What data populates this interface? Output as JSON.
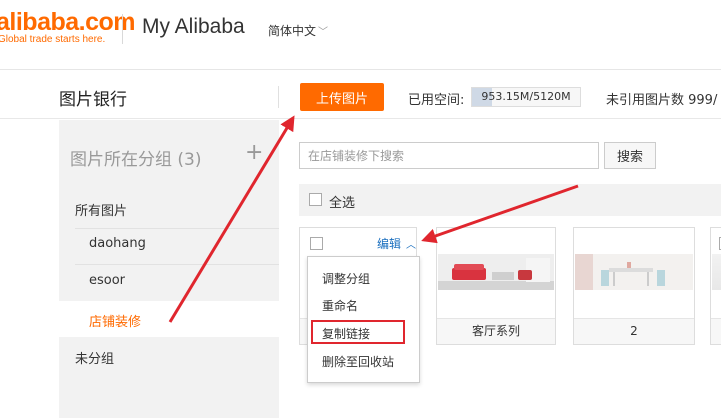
{
  "header": {
    "logo_text": "alibaba.com",
    "logo_tagline": "Global trade starts here.",
    "app_title": "My Alibaba",
    "language": "简体中文"
  },
  "subbar": {
    "page_title": "图片银行",
    "upload_label": "上传图片",
    "used_space_label": "已用空间:",
    "used_space_value": "953.15M/5120M",
    "used_space_fraction": 0.186,
    "unreferenced_label": "未引用图片数 999/"
  },
  "sidebar": {
    "heading": "图片所在分组 (3)",
    "add_label": "+",
    "items": [
      {
        "label": "所有图片"
      },
      {
        "label": "daohang"
      },
      {
        "label": "esoor"
      },
      {
        "label": "店铺装修"
      },
      {
        "label": "未分组"
      }
    ]
  },
  "main": {
    "search_placeholder": "在店铺装修下搜索",
    "search_button": "搜索",
    "select_all": "全选",
    "edit_label": "编辑",
    "cards": [
      {
        "caption": ""
      },
      {
        "caption": "客厅系列"
      },
      {
        "caption": "2"
      },
      {
        "caption": ""
      }
    ],
    "menu": [
      {
        "label": "调整分组"
      },
      {
        "label": "重命名"
      },
      {
        "label": "复制链接"
      },
      {
        "label": "删除至回收站"
      }
    ]
  },
  "colors": {
    "accent": "#ff6a00",
    "link": "#1a6fbf",
    "annotation": "#e0262e"
  }
}
